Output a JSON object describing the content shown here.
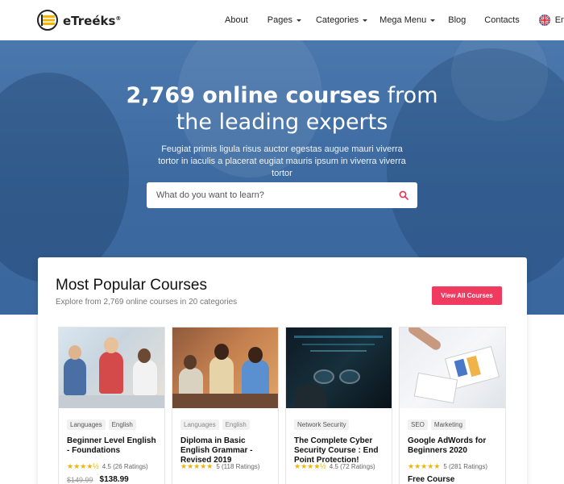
{
  "brand": {
    "name": "eTreéks",
    "reg": "®"
  },
  "nav": {
    "items": [
      {
        "label": "About",
        "caret": false
      },
      {
        "label": "Pages",
        "caret": true
      },
      {
        "label": "Categories",
        "caret": true
      },
      {
        "label": "Mega Menu",
        "caret": true
      },
      {
        "label": "Blog",
        "caret": false
      },
      {
        "label": "Contacts",
        "caret": false
      }
    ],
    "language": "En"
  },
  "hero": {
    "title_bold": "2,769 online courses",
    "title_rest_1": "from",
    "title_line2": "the leading experts",
    "subtitle": "Feugiat primis ligula risus auctor egestas augue mauri viverra tortor in iaculis a placerat eugiat mauris ipsum in viverra viverra tortor",
    "search_placeholder": "What do you want to learn?"
  },
  "popular": {
    "title": "Most Popular Courses",
    "subtitle": "Explore from 2,769 online courses in 20 categories",
    "view_all": "View All Courses",
    "courses": [
      {
        "tags": [
          "Languages",
          "English"
        ],
        "title": "Beginner Level English - Foundations",
        "stars": "★★★★½",
        "rating": "4.5 (26 Ratings)",
        "old_price": "$149.99",
        "price": "$138.99"
      },
      {
        "tags": [
          "Languages",
          "English"
        ],
        "title": "Diploma in Basic English Grammar - Revised 2019",
        "stars": "★★★★★",
        "rating": "5 (118 Ratings)",
        "old_price": "",
        "price": ""
      },
      {
        "tags": [
          "Network Security"
        ],
        "title": "The Complete Cyber Security Course : End Point Protection!",
        "stars": "★★★★½",
        "rating": "4.5 (72 Ratings)",
        "old_price": "",
        "price": ""
      },
      {
        "tags": [
          "SEO",
          "Marketing"
        ],
        "title": "Google AdWords for Beginners 2020",
        "stars": "★★★★★",
        "rating": "5 (281 Ratings)",
        "old_price": "",
        "price": "Free Course"
      }
    ]
  },
  "colors": {
    "accent": "#f03a5f",
    "hero": "#3f6ca3",
    "star": "#f4b400"
  }
}
